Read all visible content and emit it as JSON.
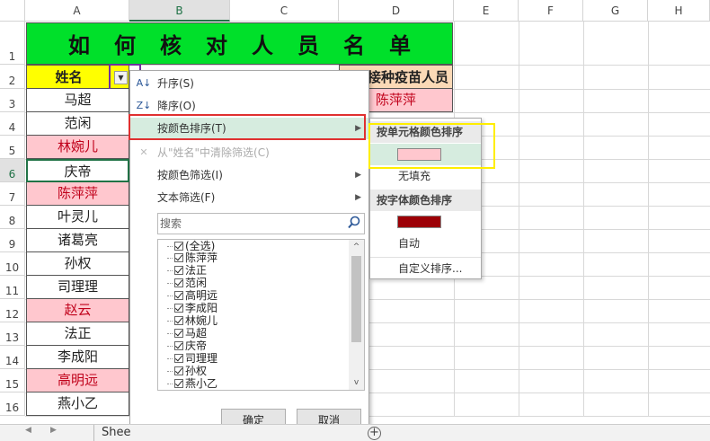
{
  "columns": [
    "A",
    "B",
    "C",
    "D",
    "E",
    "F",
    "G",
    "H"
  ],
  "rows": [
    "1",
    "2",
    "3",
    "4",
    "5",
    "6",
    "7",
    "8",
    "9",
    "10",
    "11",
    "12",
    "13",
    "14",
    "15",
    "16"
  ],
  "sheet": {
    "title": [
      "如",
      "何",
      "核",
      "对",
      "人",
      "员",
      "名",
      "单"
    ],
    "header_name": "姓名",
    "header_d": "未接种疫苗人员",
    "d3": "陈萍萍",
    "names": [
      {
        "text": "马超",
        "pink": false
      },
      {
        "text": "范闲",
        "pink": false
      },
      {
        "text": "林婉儿",
        "pink": true
      },
      {
        "text": "庆帝",
        "pink": false
      },
      {
        "text": "陈萍萍",
        "pink": true
      },
      {
        "text": "叶灵儿",
        "pink": false
      },
      {
        "text": "诸葛亮",
        "pink": false
      },
      {
        "text": "孙权",
        "pink": false
      },
      {
        "text": "司理理",
        "pink": false
      },
      {
        "text": "赵云",
        "pink": true
      },
      {
        "text": "法正",
        "pink": false
      },
      {
        "text": "李成阳",
        "pink": false
      },
      {
        "text": "高明远",
        "pink": true
      },
      {
        "text": "燕小乙",
        "pink": false
      }
    ]
  },
  "menu": {
    "sort_asc": "升序(S)",
    "sort_desc": "降序(O)",
    "sort_by_color": "按颜色排序(T)",
    "clear_filter": "从\"姓名\"中清除筛选(C)",
    "filter_by_color": "按颜色筛选(I)",
    "text_filter": "文本筛选(F)",
    "search_placeholder": "搜索",
    "list": [
      "(全选)",
      "陈萍萍",
      "法正",
      "范闲",
      "高明远",
      "李成阳",
      "林婉儿",
      "马超",
      "庆帝",
      "司理理",
      "孙权",
      "燕小乙"
    ],
    "ok": "确定",
    "cancel": "取消"
  },
  "submenu": {
    "cell_color_header": "按单元格颜色排序",
    "no_fill": "无填充",
    "font_color_header": "按字体颜色排序",
    "auto": "自动",
    "custom_sort": "自定义排序...",
    "cell_swatch_color": "#ffc7ce",
    "font_swatch_color": "#9c0006"
  },
  "tabbar": {
    "sheet_label": "Shee",
    "add_icon": "plus-circle-icon"
  }
}
